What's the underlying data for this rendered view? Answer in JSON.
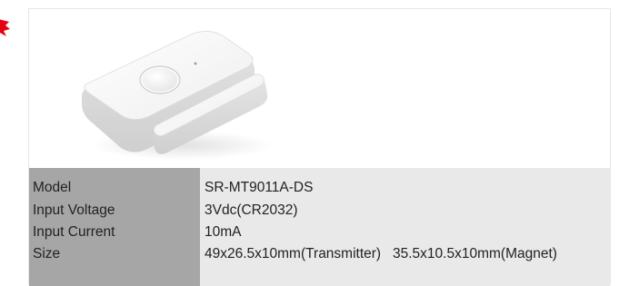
{
  "product": {
    "image_icon": "door-window-sensor-image"
  },
  "specs": {
    "rows": [
      {
        "label": "Model",
        "value": "SR-MT9011A-DS"
      },
      {
        "label": "Input Voltage",
        "value": "3Vdc(CR2032)"
      },
      {
        "label": "Input Current",
        "value": "10mA"
      },
      {
        "label": "Size",
        "value": "49x26.5x10mm(Transmitter)   35.5x10.5x10mm(Magnet)"
      }
    ]
  },
  "colors": {
    "label_bg": "#a6a6a6",
    "value_bg": "#e9e9e9",
    "accent_mark": "#e60012"
  }
}
